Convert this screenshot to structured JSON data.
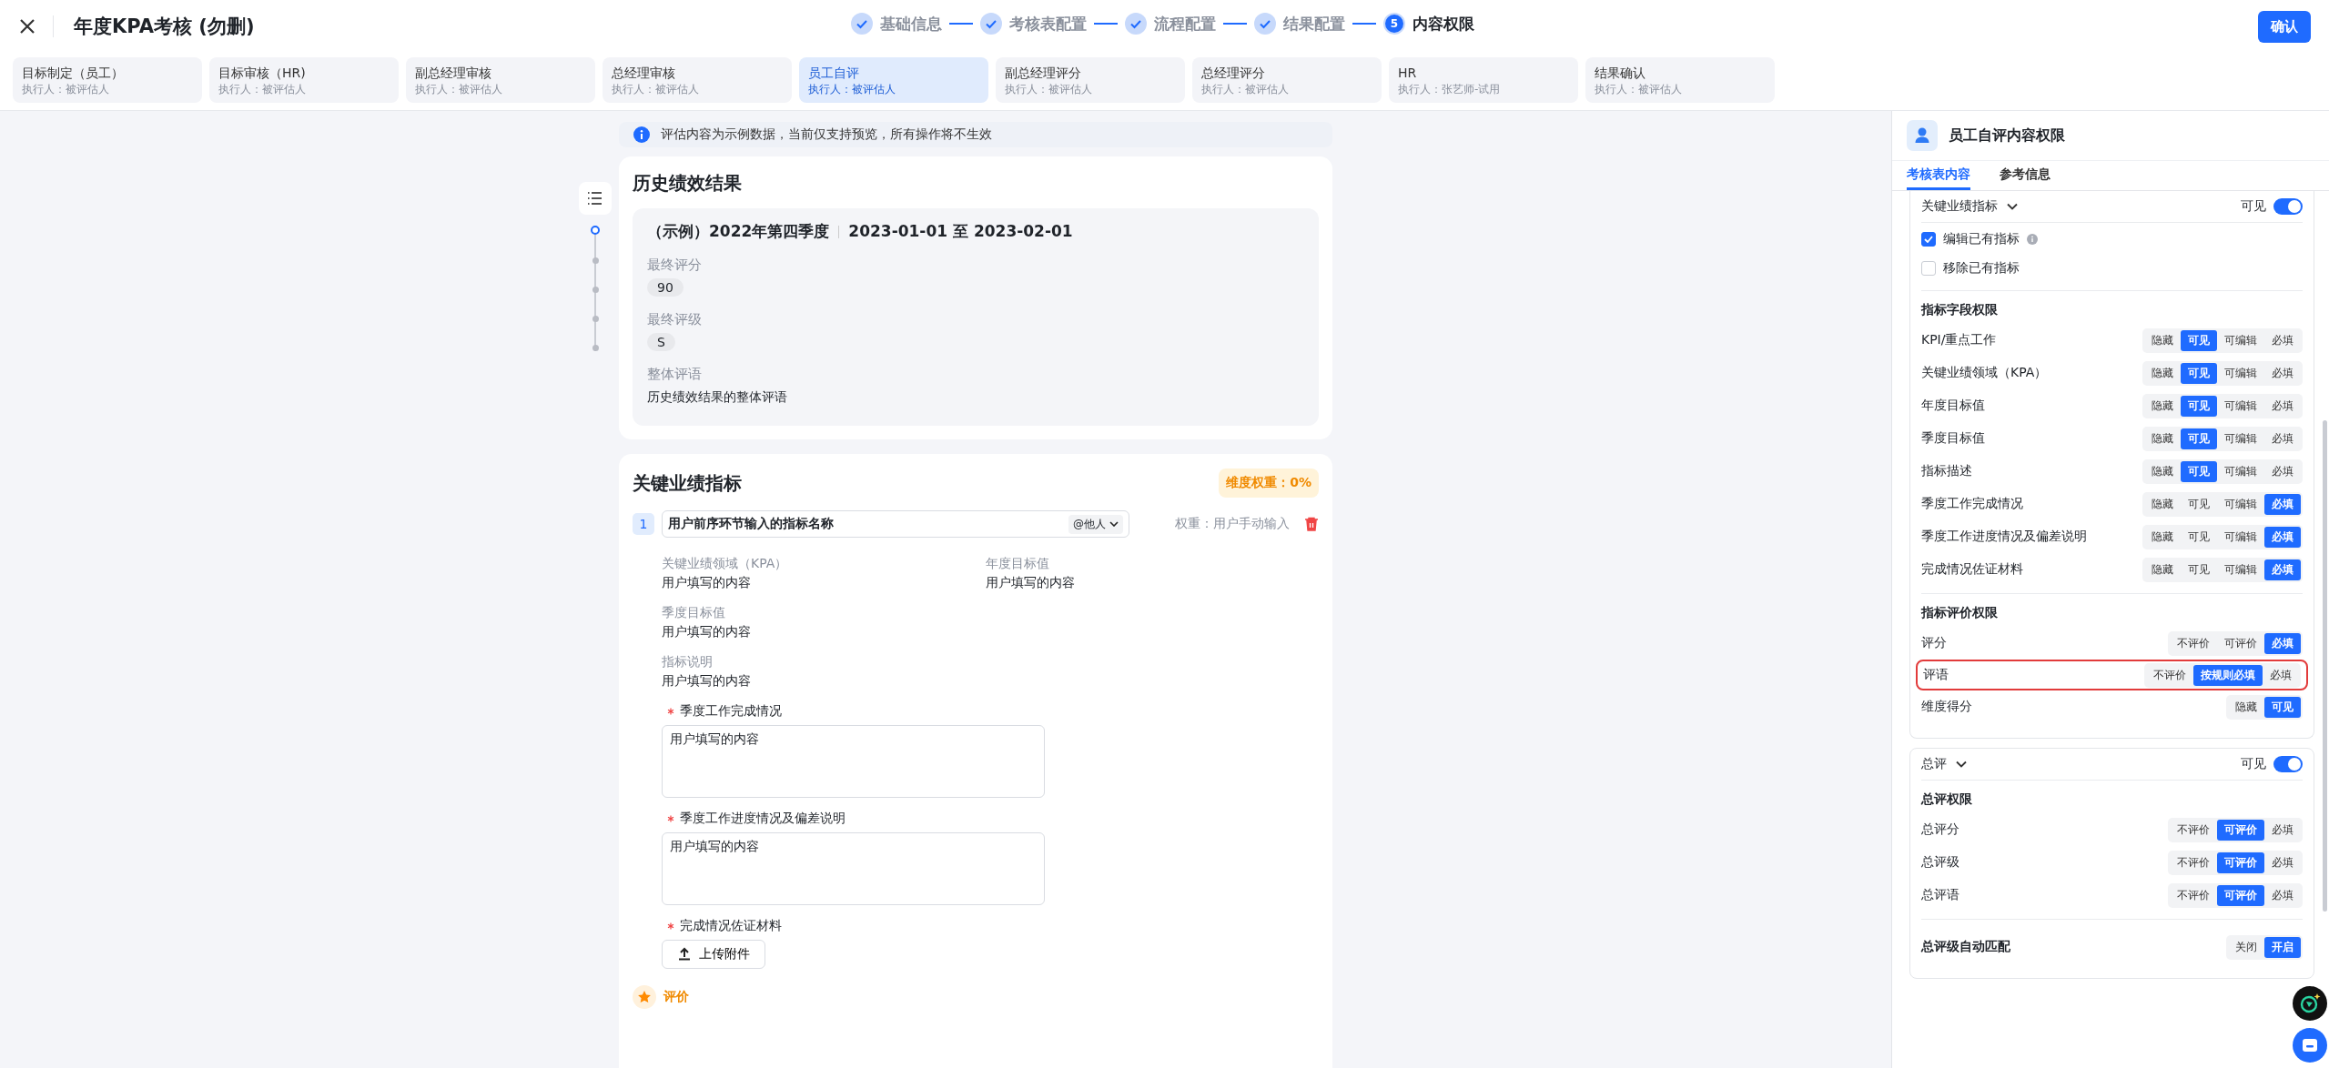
{
  "window": {
    "title": "年度KPA考核 (勿删)"
  },
  "steps": [
    {
      "label": "基础信息",
      "completed": true
    },
    {
      "label": "考核表配置",
      "completed": true
    },
    {
      "label": "流程配置",
      "completed": true
    },
    {
      "label": "结果配置",
      "completed": true
    },
    {
      "label": "内容权限",
      "completed": false,
      "number": "5"
    }
  ],
  "confirm_button": "确认",
  "stages": [
    {
      "label": "目标制定（员工）",
      "executor": "执行人：被评估人",
      "selected": false
    },
    {
      "label": "目标审核（HR)",
      "executor": "执行人：被评估人",
      "selected": false
    },
    {
      "label": "副总经理审核",
      "executor": "执行人：被评估人",
      "selected": false
    },
    {
      "label": "总经理审核",
      "executor": "执行人：被评估人",
      "selected": false
    },
    {
      "label": "员工自评",
      "executor": "执行人：被评估人",
      "selected": true
    },
    {
      "label": "副总经理评分",
      "executor": "执行人：被评估人",
      "selected": false
    },
    {
      "label": "总经理评分",
      "executor": "执行人：被评估人",
      "selected": false
    },
    {
      "label": "HR",
      "executor": "执行人：张艺师-试用",
      "selected": false
    },
    {
      "label": "结果确认",
      "executor": "执行人：被评估人",
      "selected": false
    }
  ],
  "notice": "评估内容为示例数据，当前仅支持预览，所有操作将不生效",
  "outline": [
    {
      "selected": true
    },
    {
      "selected": false
    },
    {
      "selected": false
    },
    {
      "selected": false
    },
    {
      "selected": false
    }
  ],
  "history": {
    "title": "历史绩效结果",
    "period": "（示例）2022年第四季度",
    "dates": "2023-01-01 至 2023-02-01",
    "fields": [
      {
        "label": "最终评分",
        "value": "90",
        "kind": "tag"
      },
      {
        "label": "最终评级",
        "value": "S",
        "kind": "tag"
      },
      {
        "label": "整体评语",
        "value": "历史绩效结果的整体评语",
        "kind": "text"
      }
    ]
  },
  "kpi": {
    "title": "关键业绩指标",
    "weight_badge": "维度权重：0%",
    "indicator": {
      "index": "1",
      "name": "用户前序环节输入的指标名称",
      "mention": "@他人",
      "weight": "权重：用户手动输入"
    },
    "fields": [
      {
        "label": "关键业绩领域（KPA）",
        "value": "用户填写的内容",
        "wide": false
      },
      {
        "label": "年度目标值",
        "value": "用户填写的内容",
        "wide": false
      },
      {
        "label": "季度目标值",
        "value": "用户填写的内容",
        "wide": true
      },
      {
        "label": "指标说明",
        "value": "用户填写的内容",
        "wide": true
      }
    ],
    "inputs": [
      {
        "label": "季度工作完成情况",
        "required": true,
        "kind": "textarea",
        "value": "用户填写的内容"
      },
      {
        "label": "季度工作进度情况及偏差说明",
        "required": true,
        "kind": "textarea",
        "value": "用户填写的内容"
      },
      {
        "label": "完成情况佐证材料",
        "required": true,
        "kind": "upload",
        "button": "上传附件"
      }
    ],
    "evaluation_label": "评价"
  },
  "panel": {
    "title": "员工自评内容权限",
    "tabs": [
      {
        "label": "考核表内容",
        "selected": true
      },
      {
        "label": "参考信息",
        "selected": false
      }
    ],
    "sections": [
      {
        "title": "关键业绩指标",
        "visible_label": "可见",
        "on": true,
        "checkboxes": [
          {
            "label": "编辑已有指标",
            "checked": true,
            "info": true
          },
          {
            "label": "移除已有指标",
            "checked": false,
            "info": false
          }
        ],
        "groups": [
          {
            "title": "指标字段权限",
            "rows": [
              {
                "label": "KPI/重点工作",
                "highlighted": false,
                "options": [
                  {
                    "label": "隐藏",
                    "selected": false
                  },
                  {
                    "label": "可见",
                    "selected": true
                  },
                  {
                    "label": "可编辑",
                    "selected": false
                  },
                  {
                    "label": "必填",
                    "selected": false
                  }
                ]
              },
              {
                "label": "关键业绩领域（KPA）",
                "highlighted": false,
                "options": [
                  {
                    "label": "隐藏",
                    "selected": false
                  },
                  {
                    "label": "可见",
                    "selected": true
                  },
                  {
                    "label": "可编辑",
                    "selected": false
                  },
                  {
                    "label": "必填",
                    "selected": false
                  }
                ]
              },
              {
                "label": "年度目标值",
                "highlighted": false,
                "options": [
                  {
                    "label": "隐藏",
                    "selected": false
                  },
                  {
                    "label": "可见",
                    "selected": true
                  },
                  {
                    "label": "可编辑",
                    "selected": false
                  },
                  {
                    "label": "必填",
                    "selected": false
                  }
                ]
              },
              {
                "label": "季度目标值",
                "highlighted": false,
                "options": [
                  {
                    "label": "隐藏",
                    "selected": false
                  },
                  {
                    "label": "可见",
                    "selected": true
                  },
                  {
                    "label": "可编辑",
                    "selected": false
                  },
                  {
                    "label": "必填",
                    "selected": false
                  }
                ]
              },
              {
                "label": "指标描述",
                "highlighted": false,
                "options": [
                  {
                    "label": "隐藏",
                    "selected": false
                  },
                  {
                    "label": "可见",
                    "selected": true
                  },
                  {
                    "label": "可编辑",
                    "selected": false
                  },
                  {
                    "label": "必填",
                    "selected": false
                  }
                ]
              },
              {
                "label": "季度工作完成情况",
                "highlighted": false,
                "options": [
                  {
                    "label": "隐藏",
                    "selected": false
                  },
                  {
                    "label": "可见",
                    "selected": false
                  },
                  {
                    "label": "可编辑",
                    "selected": false
                  },
                  {
                    "label": "必填",
                    "selected": true
                  }
                ]
              },
              {
                "label": "季度工作进度情况及偏差说明",
                "highlighted": false,
                "options": [
                  {
                    "label": "隐藏",
                    "selected": false
                  },
                  {
                    "label": "可见",
                    "selected": false
                  },
                  {
                    "label": "可编辑",
                    "selected": false
                  },
                  {
                    "label": "必填",
                    "selected": true
                  }
                ]
              },
              {
                "label": "完成情况佐证材料",
                "highlighted": false,
                "options": [
                  {
                    "label": "隐藏",
                    "selected": false
                  },
                  {
                    "label": "可见",
                    "selected": false
                  },
                  {
                    "label": "可编辑",
                    "selected": false
                  },
                  {
                    "label": "必填",
                    "selected": true
                  }
                ]
              }
            ]
          },
          {
            "title": "指标评价权限",
            "rows": [
              {
                "label": "评分",
                "highlighted": false,
                "options": [
                  {
                    "label": "不评价",
                    "selected": false
                  },
                  {
                    "label": "可评价",
                    "selected": false
                  },
                  {
                    "label": "必填",
                    "selected": true
                  }
                ]
              },
              {
                "label": "评语",
                "highlighted": true,
                "options": [
                  {
                    "label": "不评价",
                    "selected": false
                  },
                  {
                    "label": "按规则必填",
                    "selected": true
                  },
                  {
                    "label": "必填",
                    "selected": false
                  }
                ]
              },
              {
                "label": "维度得分",
                "highlighted": false,
                "options": [
                  {
                    "label": "隐藏",
                    "selected": false
                  },
                  {
                    "label": "可见",
                    "selected": true
                  }
                ]
              }
            ]
          }
        ]
      },
      {
        "title": "总评",
        "visible_label": "可见",
        "on": true,
        "groups": [
          {
            "title": "总评权限",
            "rows": [
              {
                "label": "总评分",
                "highlighted": false,
                "options": [
                  {
                    "label": "不评价",
                    "selected": false
                  },
                  {
                    "label": "可评价",
                    "selected": true
                  },
                  {
                    "label": "必填",
                    "selected": false
                  }
                ]
              },
              {
                "label": "总评级",
                "highlighted": false,
                "options": [
                  {
                    "label": "不评价",
                    "selected": false
                  },
                  {
                    "label": "可评价",
                    "selected": true
                  },
                  {
                    "label": "必填",
                    "selected": false
                  }
                ]
              },
              {
                "label": "总评语",
                "highlighted": false,
                "options": [
                  {
                    "label": "不评价",
                    "selected": false
                  },
                  {
                    "label": "可评价",
                    "selected": true
                  },
                  {
                    "label": "必填",
                    "selected": false
                  }
                ]
              }
            ]
          },
          {
            "title": "总评级自动匹配",
            "options": [
              {
                "label": "关闭",
                "selected": false
              },
              {
                "label": "开启",
                "selected": true
              }
            ]
          }
        ]
      }
    ]
  }
}
